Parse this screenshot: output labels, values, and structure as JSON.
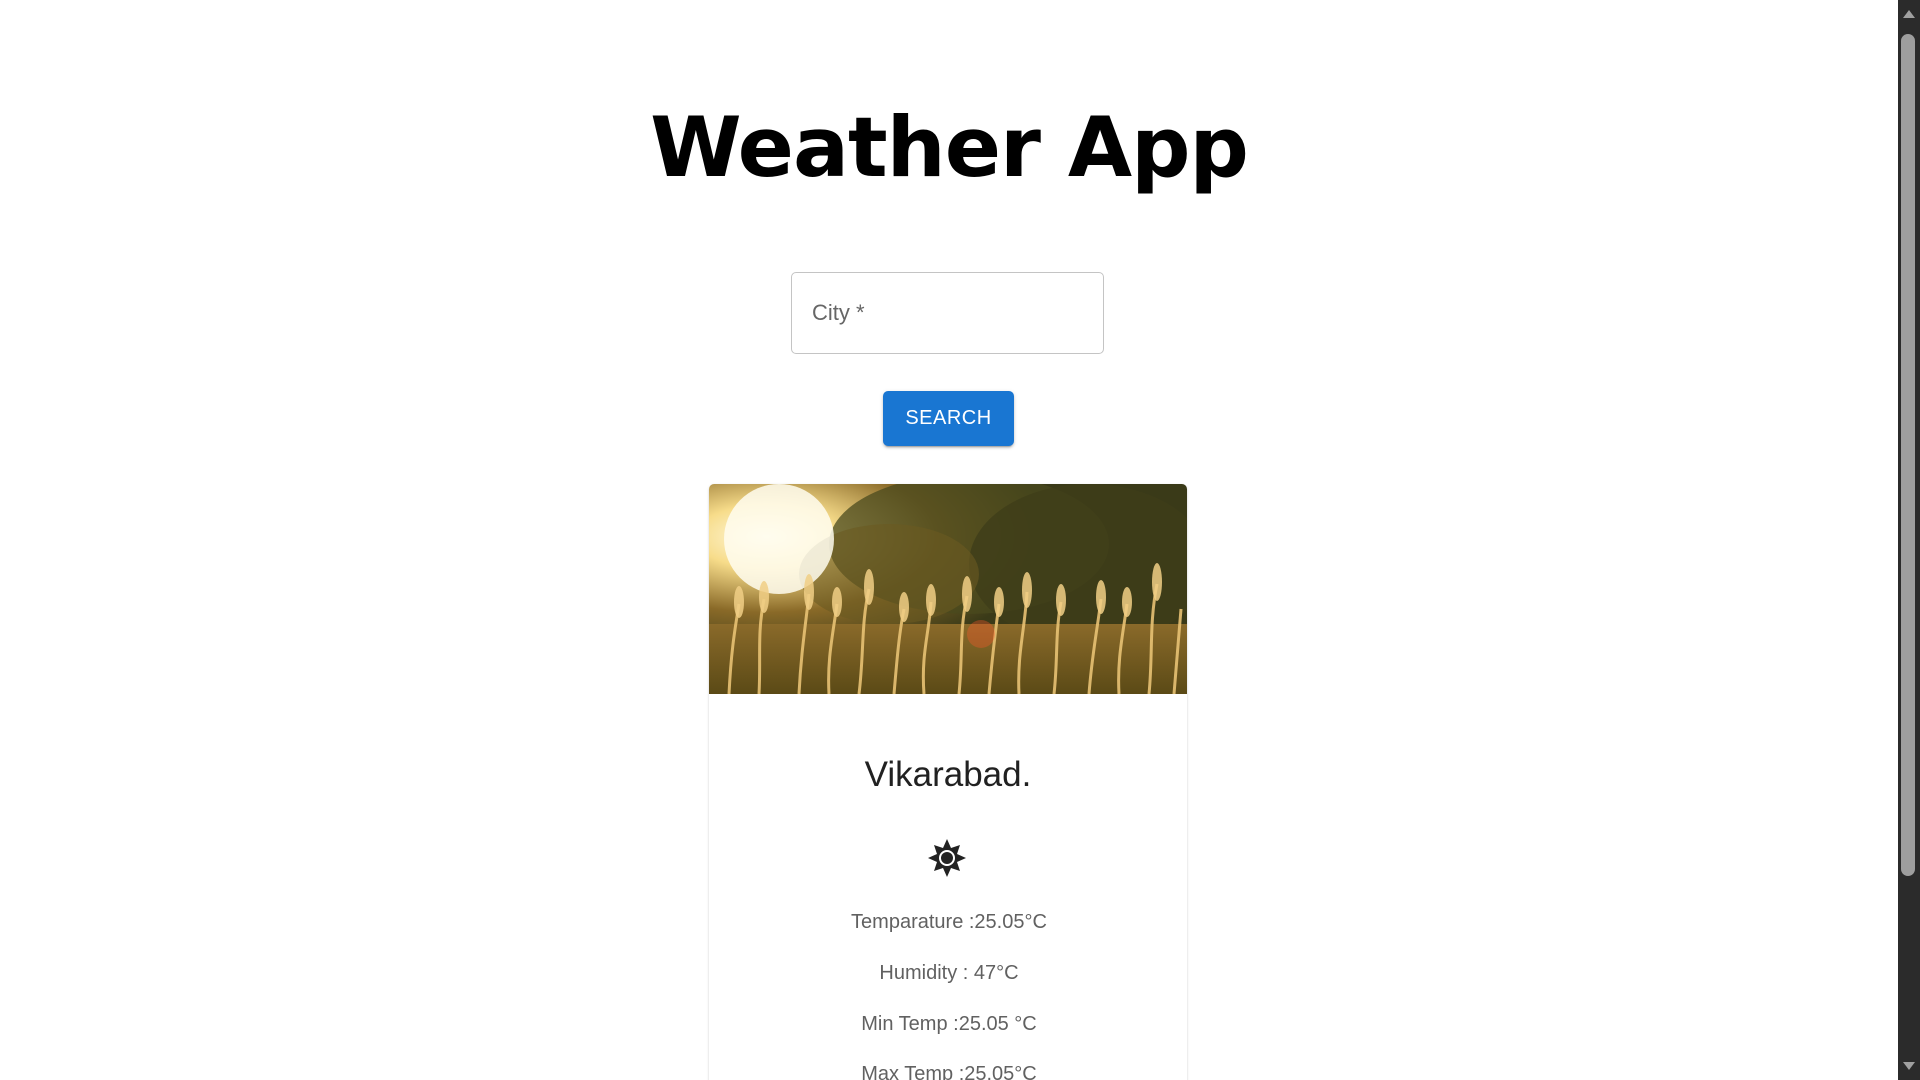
{
  "app": {
    "title": "Weather App"
  },
  "search": {
    "placeholder": "City *",
    "value": "",
    "button_label": "SEARCH"
  },
  "card": {
    "image": "sunlit-grass-field",
    "city": "Vikarabad.",
    "icon": "sun-icon",
    "temperature": "Temparature :25.05°C",
    "humidity": "Humidity : 47°C",
    "min_temp": "Min Temp :25.05 °C",
    "max_temp": "Max Temp :25.05°C"
  },
  "colors": {
    "primary": "#1976d2",
    "text": "#212121",
    "muted": "#616161"
  }
}
